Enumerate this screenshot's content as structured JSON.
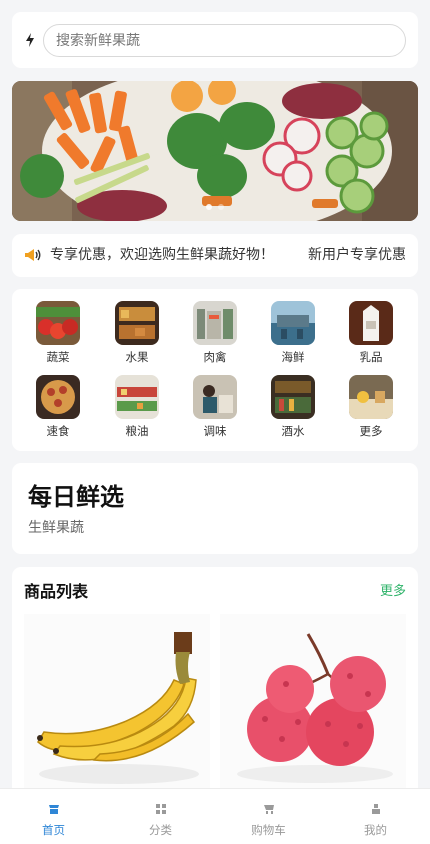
{
  "search": {
    "placeholder": "搜索新鲜果蔬"
  },
  "notice": {
    "message": "新用户专享优惠，欢迎选购生鲜果蔬好物！",
    "right_text": "新用户专享优惠"
  },
  "categories": [
    {
      "label": "蔬菜",
      "icon": "vegetables-thumb"
    },
    {
      "label": "水果",
      "icon": "fruit-thumb"
    },
    {
      "label": "肉禽",
      "icon": "meat-thumb"
    },
    {
      "label": "海鲜",
      "icon": "seafood-thumb"
    },
    {
      "label": "乳品",
      "icon": "dairy-thumb"
    },
    {
      "label": "速食",
      "icon": "fastfood-thumb"
    },
    {
      "label": "粮油",
      "icon": "grain-oil-thumb"
    },
    {
      "label": "调味",
      "icon": "seasoning-thumb"
    },
    {
      "label": "酒水",
      "icon": "drinks-thumb"
    },
    {
      "label": "更多",
      "icon": "more-thumb"
    }
  ],
  "daily": {
    "title": "每日鲜选",
    "subtitle": "生鲜果蔬"
  },
  "products": {
    "title": "商品列表",
    "more": "更多",
    "items": [
      {
        "image": "banana-image"
      },
      {
        "image": "lychee-image"
      }
    ]
  },
  "tabs": [
    {
      "label": "首页",
      "icon": "home-icon",
      "active": true
    },
    {
      "label": "分类",
      "icon": "grid-icon",
      "active": false
    },
    {
      "label": "购物车",
      "icon": "cart-icon",
      "active": false
    },
    {
      "label": "我的",
      "icon": "user-icon",
      "active": false
    }
  ],
  "colors": {
    "accent": "#2f86d6",
    "more_link": "#2fb36a",
    "background": "#f4f5f7"
  }
}
